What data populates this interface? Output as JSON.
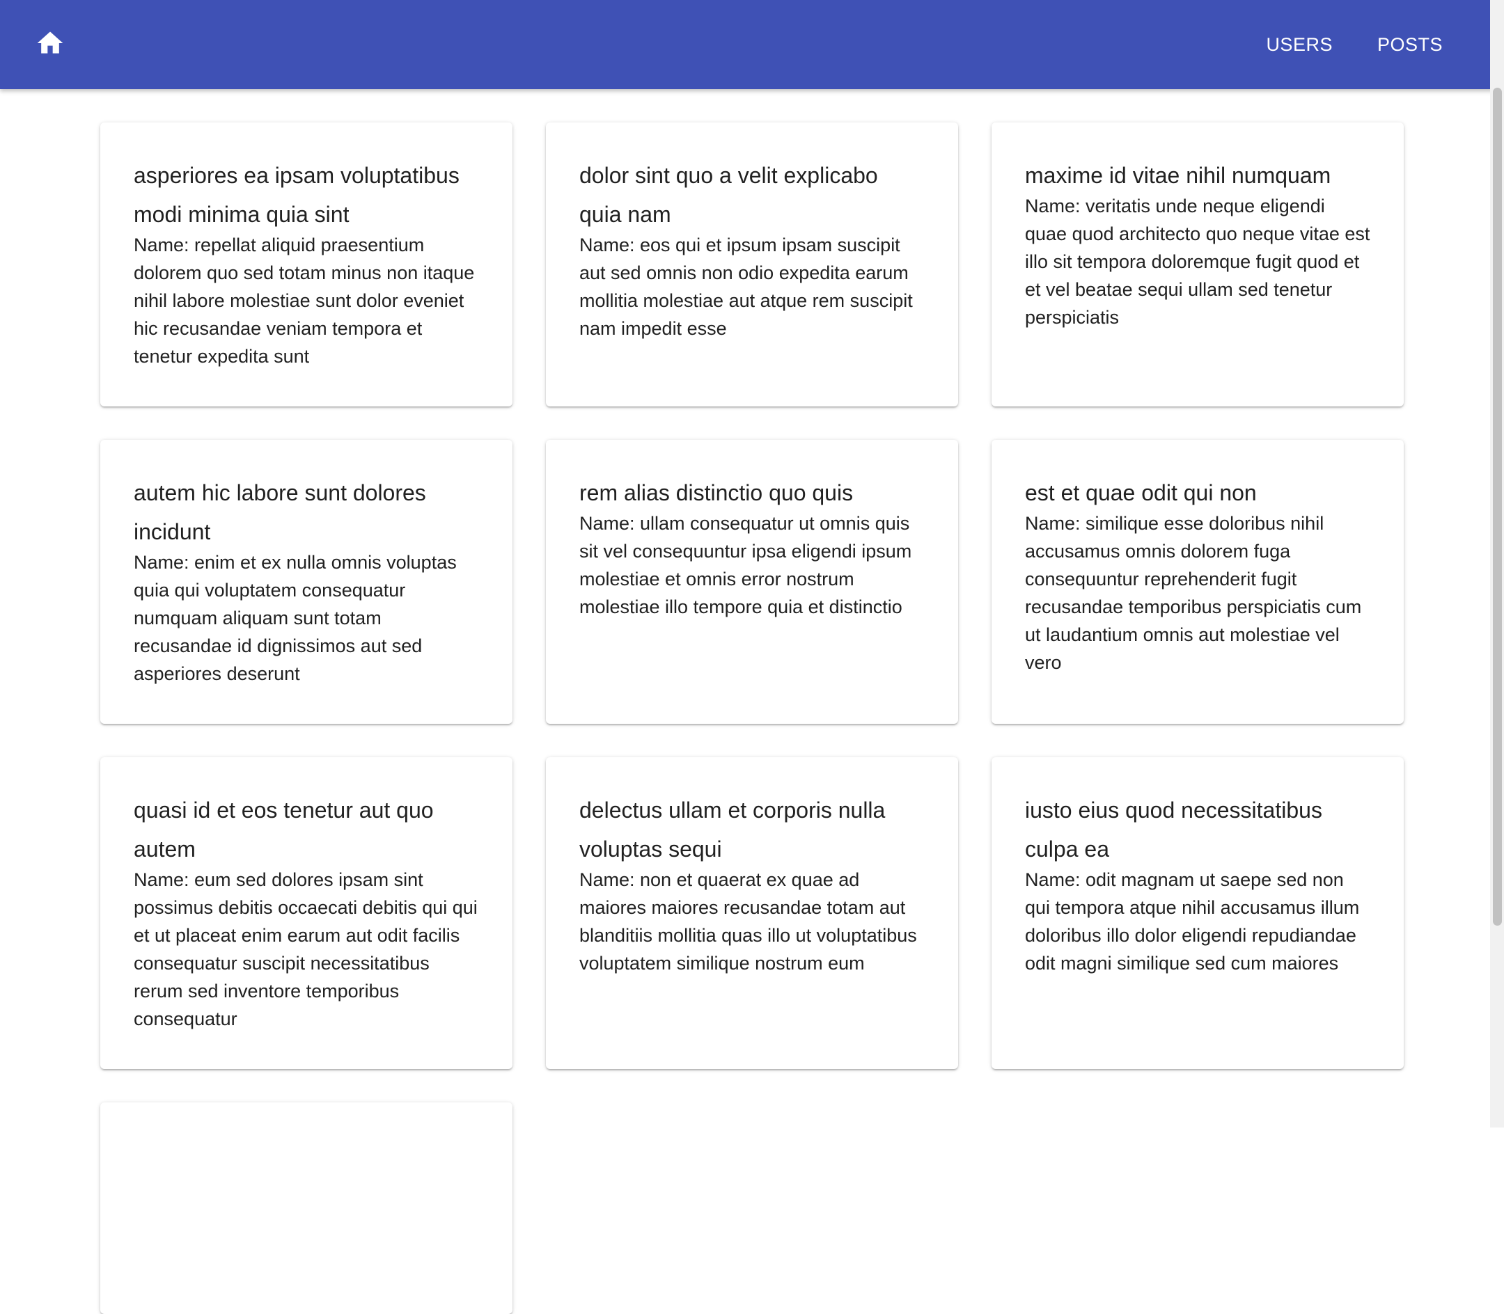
{
  "header": {
    "home_icon": "home-icon",
    "nav": [
      {
        "label": "USERS"
      },
      {
        "label": "POSTS"
      }
    ],
    "color": "#3f51b5"
  },
  "posts": [
    {
      "title": "asperiores ea ipsam voluptatibus modi minima quia sint",
      "body": "Name: repellat aliquid praesentium dolorem quo sed totam minus non itaque nihil labore molestiae sunt dolor eveniet hic recusandae veniam tempora et tenetur expedita sunt"
    },
    {
      "title": "dolor sint quo a velit explicabo quia nam",
      "body": "Name: eos qui et ipsum ipsam suscipit aut sed omnis non odio expedita earum mollitia molestiae aut atque rem suscipit nam impedit esse"
    },
    {
      "title": "maxime id vitae nihil numquam",
      "body": "Name: veritatis unde neque eligendi quae quod architecto quo neque vitae est illo sit tempora doloremque fugit quod et et vel beatae sequi ullam sed tenetur perspiciatis"
    },
    {
      "title": "autem hic labore sunt dolores incidunt",
      "body": "Name: enim et ex nulla omnis voluptas quia qui voluptatem consequatur numquam aliquam sunt totam recusandae id dignissimos aut sed asperiores deserunt"
    },
    {
      "title": "rem alias distinctio quo quis",
      "body": "Name: ullam consequatur ut omnis quis sit vel consequuntur ipsa eligendi ipsum molestiae et omnis error nostrum molestiae illo tempore quia et distinctio"
    },
    {
      "title": "est et quae odit qui non",
      "body": "Name: similique esse doloribus nihil accusamus omnis dolorem fuga consequuntur reprehenderit fugit recusandae temporibus perspiciatis cum ut laudantium omnis aut molestiae vel vero"
    },
    {
      "title": "quasi id et eos tenetur aut quo autem",
      "body": "Name: eum sed dolores ipsam sint possimus debitis occaecati debitis qui qui et ut placeat enim earum aut odit facilis consequatur suscipit necessitatibus rerum sed inventore temporibus consequatur"
    },
    {
      "title": "delectus ullam et corporis nulla voluptas sequi",
      "body": "Name: non et quaerat ex quae ad maiores maiores recusandae totam aut blanditiis mollitia quas illo ut voluptatibus voluptatem similique nostrum eum"
    },
    {
      "title": "iusto eius quod necessitatibus culpa ea",
      "body": "Name: odit magnam ut saepe sed non qui tempora atque nihil accusamus illum doloribus illo dolor eligendi repudiandae odit magni similique sed cum maiores"
    }
  ]
}
